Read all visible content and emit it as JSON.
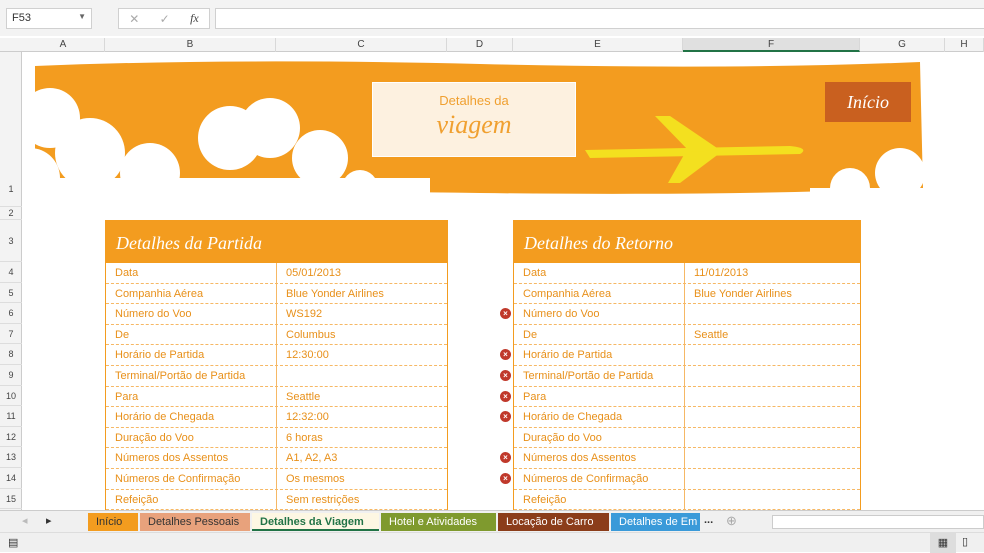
{
  "formula_bar": {
    "name_box": "F53",
    "cancel": "✕",
    "enter": "✓",
    "fx": "fx",
    "value": ""
  },
  "columns": [
    "A",
    "B",
    "C",
    "D",
    "E",
    "F",
    "G",
    "H"
  ],
  "rows": [
    "1",
    "2",
    "3",
    "4",
    "5",
    "6",
    "7",
    "8",
    "9",
    "10",
    "11",
    "12",
    "13",
    "14",
    "15"
  ],
  "banner": {
    "title_line1": "Detalhes da",
    "title_line2": "viagem",
    "home_button": "Início"
  },
  "departure": {
    "title": "Detalhes da Partida",
    "rows": [
      [
        "Data",
        "05/01/2013"
      ],
      [
        "Companhia Aérea",
        "Blue Yonder Airlines"
      ],
      [
        "Número do Voo",
        "WS192"
      ],
      [
        "De",
        "Columbus"
      ],
      [
        "Horário de Partida",
        "12:30:00"
      ],
      [
        "Terminal/Portão de Partida",
        ""
      ],
      [
        "Para",
        "Seattle"
      ],
      [
        "Horário de Chegada",
        "12:32:00"
      ],
      [
        "Duração do Voo",
        "6 horas"
      ],
      [
        "Números dos Assentos",
        "A1, A2, A3"
      ],
      [
        "Números de Confirmação",
        "Os mesmos"
      ],
      [
        "Refeição",
        "Sem restrições"
      ]
    ]
  },
  "return": {
    "title": "Detalhes do Retorno",
    "rows": [
      [
        "Data",
        "11/01/2013"
      ],
      [
        "Companhia Aérea",
        "Blue Yonder Airlines"
      ],
      [
        "Número do Voo",
        ""
      ],
      [
        "De",
        "Seattle"
      ],
      [
        "Horário de Partida",
        ""
      ],
      [
        "Terminal/Portão de Partida",
        ""
      ],
      [
        "Para",
        ""
      ],
      [
        "Horário de Chegada",
        ""
      ],
      [
        "Duração do Voo",
        ""
      ],
      [
        "Números dos Assentos",
        ""
      ],
      [
        "Números de Confirmação",
        ""
      ],
      [
        "Refeição",
        ""
      ]
    ],
    "error_rows": [
      2,
      4,
      5,
      6,
      7,
      9,
      10
    ]
  },
  "sheet_tabs": [
    {
      "label": "Início",
      "color": "#f39c1f"
    },
    {
      "label": "Detalhes Pessoais",
      "color": "#e8a27c"
    },
    {
      "label": "Detalhes da Viagem",
      "color": "#fdf7e3"
    },
    {
      "label": "Hotel e Atividades",
      "color": "#7f9a2e"
    },
    {
      "label": "Locação de Carro",
      "color": "#8b3d1a"
    },
    {
      "label": "Detalhes de Em",
      "color": "#3a9ad9"
    }
  ],
  "more_tabs": "..."
}
